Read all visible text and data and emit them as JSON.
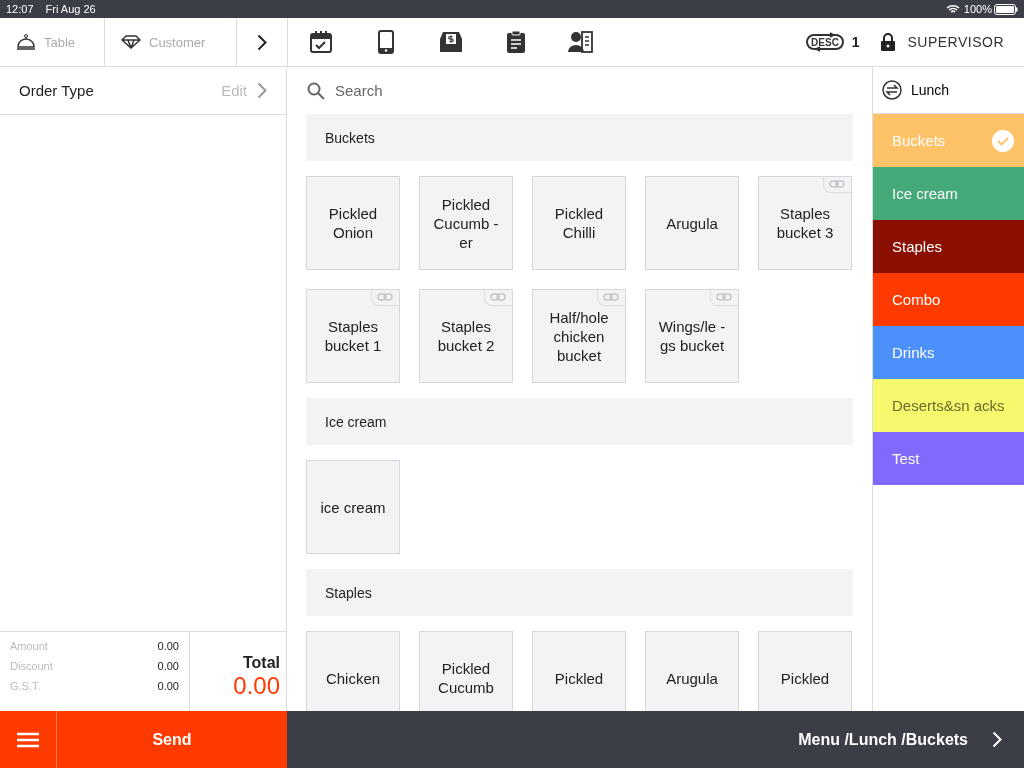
{
  "status_bar": {
    "time": "12:07",
    "date": "Fri Aug 26",
    "battery": "100%"
  },
  "top_bar": {
    "table_label": "Table",
    "customer_label": "Customer",
    "desc_label": "DESC",
    "desc_count": "1",
    "user": "SUPERVISOR"
  },
  "order": {
    "title": "Order Type",
    "edit": "Edit"
  },
  "totals": {
    "rows": [
      {
        "label": "Amount",
        "value": "0.00"
      },
      {
        "label": "Discount",
        "value": "0.00"
      },
      {
        "label": "G.S.T.",
        "value": "0.00"
      }
    ],
    "total_label": "Total",
    "total_value": "0.00"
  },
  "search": {
    "placeholder": "Search"
  },
  "sections": [
    {
      "title": "Buckets",
      "items": [
        {
          "name": "Pickled Onion",
          "linked": false
        },
        {
          "name": "Pickled Cucumb -er",
          "linked": false
        },
        {
          "name": "Pickled Chilli",
          "linked": false
        },
        {
          "name": "Arugula",
          "linked": false
        },
        {
          "name": "Staples bucket  3",
          "linked": true
        },
        {
          "name": "Staples bucket  1",
          "linked": true
        },
        {
          "name": "Staples bucket  2",
          "linked": true
        },
        {
          "name": "Half/hole chicken bucket",
          "linked": true
        },
        {
          "name": "Wings/le -gs bucket",
          "linked": true
        }
      ]
    },
    {
      "title": "Ice cream",
      "items": [
        {
          "name": "ice  cream",
          "linked": false
        }
      ]
    },
    {
      "title": "Staples",
      "items": [
        {
          "name": "Chicken",
          "linked": false
        },
        {
          "name": "Pickled Cucumb",
          "linked": false
        },
        {
          "name": "Pickled",
          "linked": false
        },
        {
          "name": "Arugula",
          "linked": false
        },
        {
          "name": "Pickled",
          "linked": false
        }
      ]
    }
  ],
  "menu": {
    "title": "Lunch",
    "categories": [
      {
        "name": "Buckets",
        "color": "#fec268",
        "selected": true
      },
      {
        "name": "Ice cream",
        "color": "#45a97a",
        "selected": false
      },
      {
        "name": "Staples",
        "color": "#8b1003",
        "selected": false
      },
      {
        "name": "Combo",
        "color": "#ff3a00",
        "selected": false
      },
      {
        "name": "Drinks",
        "color": "#4c90fc",
        "selected": false
      },
      {
        "name": "Deserts&sn acks",
        "color": "#f6f86e",
        "selected": false
      },
      {
        "name": "Test",
        "color": "#8069fd",
        "selected": false
      }
    ]
  },
  "bottom_bar": {
    "send": "Send",
    "breadcrumb": "Menu /Lunch /Buckets"
  }
}
